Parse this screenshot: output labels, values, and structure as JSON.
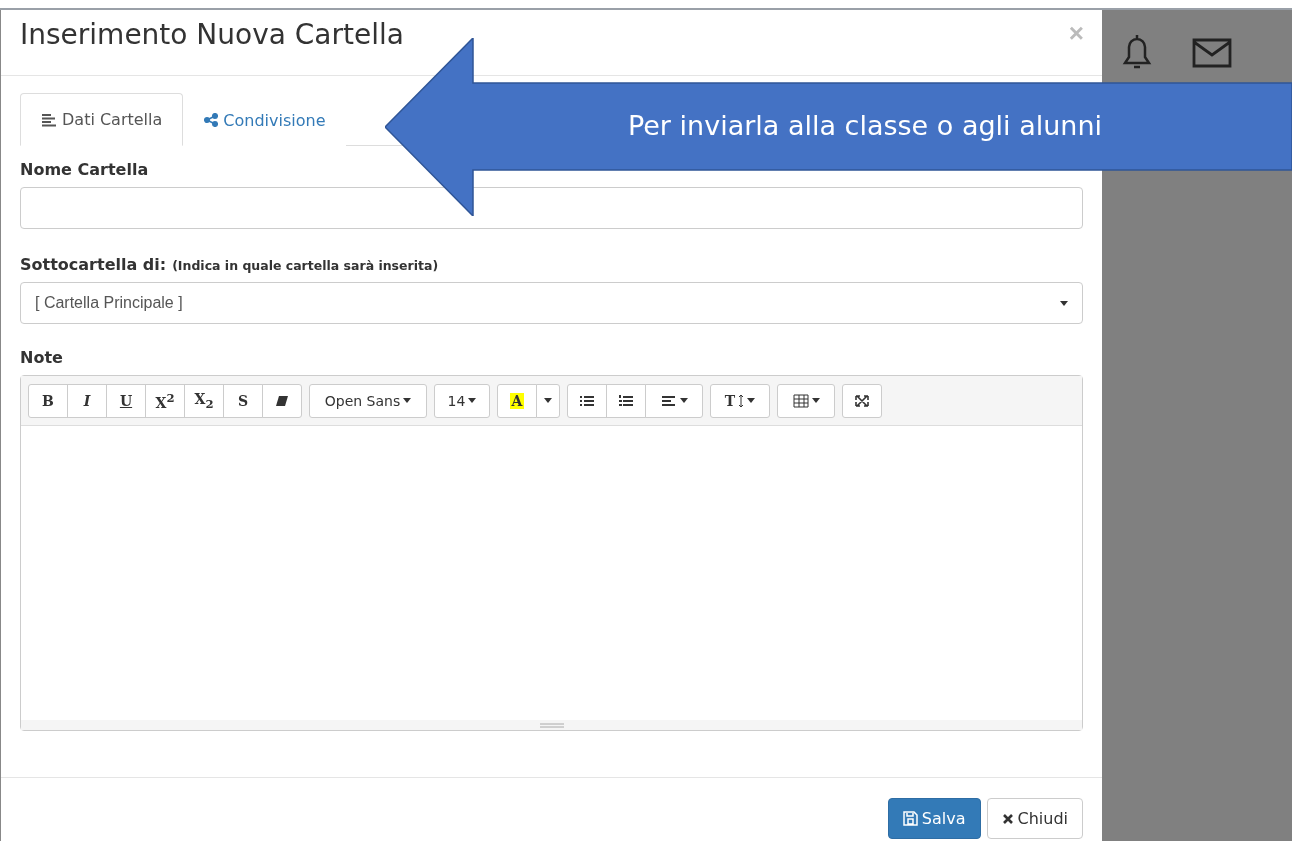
{
  "modal": {
    "title": "Inserimento Nuova Cartella",
    "close": "×",
    "tabs": [
      {
        "label": "Dati Cartella",
        "kind": "lines",
        "selected": true
      },
      {
        "label": "Condivisione",
        "kind": "share",
        "selected": false
      }
    ],
    "fields": [
      {
        "kind": "text",
        "label": "Nome Cartella"
      },
      {
        "kind": "select",
        "label": "Sottocartella di:",
        "hint": "(Indica in quale cartella sarà inserita)",
        "value": "[ Cartella Principale ]"
      }
    ],
    "editor": {
      "label": "Note",
      "toolbar": [
        [
          {
            "kind": "bold",
            "text": "B"
          },
          {
            "kind": "italic",
            "text": "I"
          },
          {
            "kind": "underline",
            "text": "U"
          },
          {
            "kind": "super",
            "text": "X$^{2}$"
          },
          {
            "kind": "sub",
            "text": "X$_{2}$"
          },
          {
            "kind": "strike",
            "text": "S"
          },
          {
            "kind": "eraser"
          }
        ],
        [
          {
            "kind": "dropdown",
            "text": "Open Sans"
          }
        ],
        [
          {
            "kind": "dropdown",
            "text": "14"
          }
        ],
        [
          {
            "kind": "color",
            "text": "A"
          },
          {
            "kind": "caret"
          }
        ],
        [
          {
            "kind": "ul"
          },
          {
            "kind": "ol"
          },
          {
            "kind": "align"
          }
        ],
        [
          {
            "kind": "height",
            "text": "T"
          }
        ],
        [
          {
            "kind": "table"
          }
        ],
        [
          {
            "kind": "fullscreen"
          }
        ]
      ]
    },
    "buttons": [
      {
        "label": "Salva",
        "kind": "primary"
      },
      {
        "label": "Chiudi",
        "kind": "default"
      }
    ]
  },
  "callout": {
    "text": "Per inviarla alla classe o agli alunni"
  }
}
